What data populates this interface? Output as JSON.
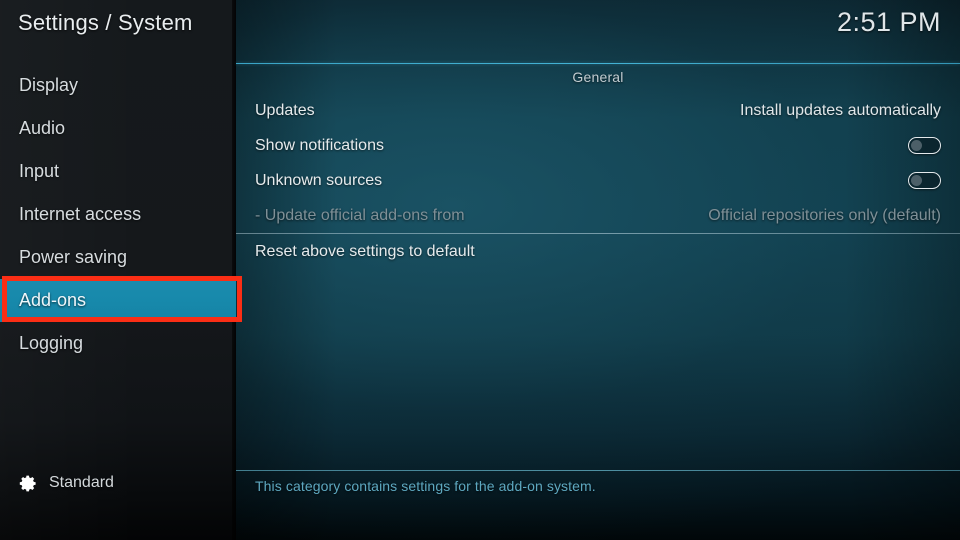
{
  "window": {
    "title": "Settings / System",
    "clock": "2:51 PM"
  },
  "sidebar": {
    "items": [
      {
        "label": "Display",
        "selected": false
      },
      {
        "label": "Audio",
        "selected": false
      },
      {
        "label": "Input",
        "selected": false
      },
      {
        "label": "Internet access",
        "selected": false
      },
      {
        "label": "Power saving",
        "selected": false
      },
      {
        "label": "Add-ons",
        "selected": true
      },
      {
        "label": "Logging",
        "selected": false
      }
    ],
    "settings_level": {
      "icon": "gear-icon",
      "label": "Standard"
    }
  },
  "main": {
    "group_header": "General",
    "rows": [
      {
        "label": "Updates",
        "value": "Install updates automatically",
        "control": "value",
        "disabled": false
      },
      {
        "label": "Show notifications",
        "value": "off",
        "control": "toggle",
        "disabled": false
      },
      {
        "label": "Unknown sources",
        "value": "off",
        "control": "toggle",
        "disabled": false
      },
      {
        "label": "- Update official add-ons from",
        "value": "Official repositories only (default)",
        "control": "value",
        "disabled": true
      },
      {
        "label": "Reset above settings to default",
        "value": "",
        "control": "none",
        "disabled": false
      }
    ],
    "help_text": "This category contains settings for the add-on system."
  },
  "annotation": {
    "target": "Add-ons",
    "color": "#fb2e15"
  },
  "colors": {
    "selection": "#1789ab",
    "accent_rule": "#46b9dc",
    "help_text": "#5ea8c0",
    "sidebar_bg": "#15191c",
    "main_bg": "#124251",
    "annotation": "#fb2e15"
  }
}
